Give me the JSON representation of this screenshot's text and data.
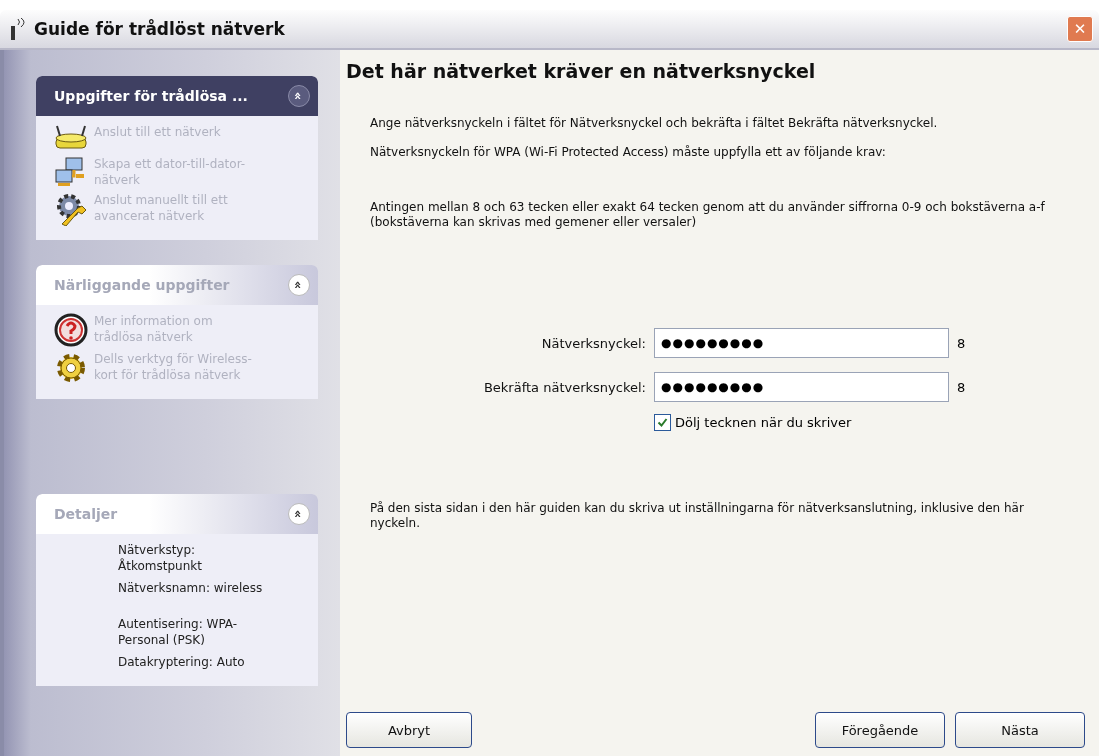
{
  "window": {
    "title": "Guide för trådlöst nätverk",
    "close": "✕"
  },
  "sidebar": {
    "panels": [
      {
        "title": "Uppgifter för trådlösa ...",
        "collapse": "«",
        "items": [
          {
            "text": "Anslut till ett nätverk",
            "disabled": true
          },
          {
            "text": "Skapa ett dator-till-dator-nätverk",
            "disabled": true
          },
          {
            "text": "Anslut manuellt till ett avancerat nätverk",
            "disabled": true
          }
        ]
      },
      {
        "title": "Närliggande uppgifter",
        "collapse": "«",
        "items": [
          {
            "text": "Mer information om trådlösa nätverk",
            "disabled": true
          },
          {
            "text": "Dells verktyg för Wireless-kort för trådlösa nätverk",
            "disabled": true
          }
        ]
      },
      {
        "title": "Detaljer",
        "collapse": "«",
        "details": [
          "Nätverkstyp: Åtkomstpunkt",
          "Nätverksnamn: wireless",
          "Autentisering: WPA-Personal (PSK)",
          "Datakryptering: Auto"
        ]
      }
    ]
  },
  "content": {
    "heading": "Det här nätverket kräver en nätverksnyckel",
    "paragraphs": [
      "Ange nätverksnyckeln i fältet för Nätverksnyckel och bekräfta i fältet Bekräfta nätverksnyckel.",
      "Nätverksnyckeln för WPA (Wi-Fi Protected Access) måste uppfylla ett av följande krav:",
      "Antingen mellan 8 och 63 tecken eller exakt 64 tecken genom att du använder siffrorna 0-9 och bokstäverna a-f (bokstäverna kan skrivas med gemener eller versaler)"
    ],
    "fields": [
      {
        "label": "Nätverksnyckel:",
        "value": "●●●●●●●●●",
        "count": "8"
      },
      {
        "label": "Bekräfta nätverksnyckel:",
        "value": "●●●●●●●●●",
        "count": "8"
      }
    ],
    "checkbox": {
      "label": "Dölj tecknen när du skriver",
      "checked": true
    },
    "footer_text": "På den sista sidan i den här guiden kan du skriva ut inställningarna för nätverksanslutning, inklusive den här nyckeln."
  },
  "buttons": [
    {
      "label": "Avbryt"
    },
    {
      "label": "Föregående"
    },
    {
      "label": "Nästa"
    }
  ]
}
